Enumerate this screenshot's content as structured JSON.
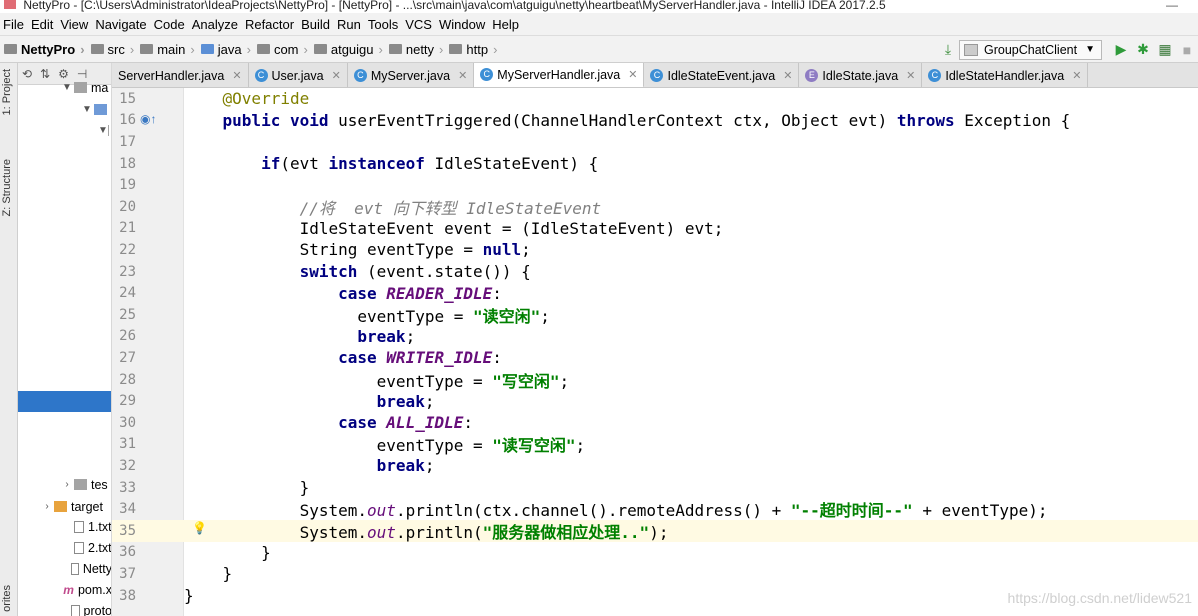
{
  "window": {
    "title": "NettyPro - [C:\\Users\\Administrator\\IdeaProjects\\NettyPro] - [NettyPro] - ...\\src\\main\\java\\com\\atguigu\\netty\\heartbeat\\MyServerHandler.java - IntelliJ IDEA 2017.2.5"
  },
  "menu": [
    "File",
    "Edit",
    "View",
    "Navigate",
    "Code",
    "Analyze",
    "Refactor",
    "Build",
    "Run",
    "Tools",
    "VCS",
    "Window",
    "Help"
  ],
  "breadcrumb": [
    "NettyPro",
    "src",
    "main",
    "java",
    "com",
    "atguigu",
    "netty",
    "http"
  ],
  "run_config": "GroupChatClient",
  "tool_windows": [
    "1: Project",
    "Z: Structure",
    "orites"
  ],
  "project_tree": [
    {
      "label": "ma"
    },
    {
      "label": ""
    },
    {
      "label": ""
    },
    {
      "label": "tes"
    },
    {
      "label": "target"
    },
    {
      "label": "1.txt"
    },
    {
      "label": "2.txt"
    },
    {
      "label": "Netty"
    },
    {
      "label": "pom.x"
    },
    {
      "label": "proto"
    }
  ],
  "tabs": [
    {
      "label": "ServerHandler.java",
      "active": false
    },
    {
      "label": "User.java",
      "active": false
    },
    {
      "label": "MyServer.java",
      "active": false
    },
    {
      "label": "MyServerHandler.java",
      "active": true
    },
    {
      "label": "IdleStateEvent.java",
      "active": false
    },
    {
      "label": "IdleState.java",
      "active": false
    },
    {
      "label": "IdleStateHandler.java",
      "active": false
    }
  ],
  "code_lines": [
    {
      "n": "15",
      "parts": [
        [
          "ann",
          "    @Override"
        ]
      ]
    },
    {
      "n": "16",
      "parts": [
        [
          "kw",
          "    public void "
        ],
        [
          "",
          "userEventTriggered(ChannelHandlerContext ctx, Object evt) "
        ],
        [
          "kw",
          "throws "
        ],
        [
          "",
          "Exception {"
        ]
      ]
    },
    {
      "n": "17",
      "parts": [
        [
          "",
          ""
        ]
      ]
    },
    {
      "n": "18",
      "parts": [
        [
          "",
          "        "
        ],
        [
          "kw",
          "if"
        ],
        [
          "",
          "(evt "
        ],
        [
          "kw",
          "instanceof "
        ],
        [
          "",
          "IdleStateEvent) {"
        ]
      ]
    },
    {
      "n": "19",
      "parts": [
        [
          "",
          ""
        ]
      ]
    },
    {
      "n": "20",
      "parts": [
        [
          "cmt",
          "            //将  evt 向下转型 IdleStateEvent"
        ]
      ]
    },
    {
      "n": "21",
      "parts": [
        [
          "",
          "            IdleStateEvent event = (IdleStateEvent) evt;"
        ]
      ]
    },
    {
      "n": "22",
      "parts": [
        [
          "",
          "            String eventType = "
        ],
        [
          "kw",
          "null"
        ],
        [
          "",
          ";"
        ]
      ]
    },
    {
      "n": "23",
      "parts": [
        [
          "",
          "            "
        ],
        [
          "kw",
          "switch "
        ],
        [
          "",
          "(event.state()) {"
        ]
      ]
    },
    {
      "n": "24",
      "parts": [
        [
          "",
          "                "
        ],
        [
          "kw",
          "case "
        ],
        [
          "field",
          "READER_IDLE"
        ],
        [
          "",
          ":"
        ]
      ]
    },
    {
      "n": "25",
      "parts": [
        [
          "",
          "                  eventType = "
        ],
        [
          "str",
          "\"读空闲\""
        ],
        [
          "",
          ";"
        ]
      ]
    },
    {
      "n": "26",
      "parts": [
        [
          "",
          "                  "
        ],
        [
          "kw",
          "break"
        ],
        [
          "",
          ";"
        ]
      ]
    },
    {
      "n": "27",
      "parts": [
        [
          "",
          "                "
        ],
        [
          "kw",
          "case "
        ],
        [
          "field",
          "WRITER_IDLE"
        ],
        [
          "",
          ":"
        ]
      ]
    },
    {
      "n": "28",
      "parts": [
        [
          "",
          "                    eventType = "
        ],
        [
          "str",
          "\"写空闲\""
        ],
        [
          "",
          ";"
        ]
      ]
    },
    {
      "n": "29",
      "parts": [
        [
          "",
          "                    "
        ],
        [
          "kw",
          "break"
        ],
        [
          "",
          ";"
        ]
      ]
    },
    {
      "n": "30",
      "parts": [
        [
          "",
          "                "
        ],
        [
          "kw",
          "case "
        ],
        [
          "field",
          "ALL_IDLE"
        ],
        [
          "",
          ":"
        ]
      ]
    },
    {
      "n": "31",
      "parts": [
        [
          "",
          "                    eventType = "
        ],
        [
          "str",
          "\"读写空闲\""
        ],
        [
          "",
          ";"
        ]
      ]
    },
    {
      "n": "32",
      "parts": [
        [
          "",
          "                    "
        ],
        [
          "kw",
          "break"
        ],
        [
          "",
          ";"
        ]
      ]
    },
    {
      "n": "33",
      "parts": [
        [
          "",
          "            }"
        ]
      ]
    },
    {
      "n": "34",
      "parts": [
        [
          "",
          "            System."
        ],
        [
          "sfield",
          "out"
        ],
        [
          "",
          ".println(ctx.channel().remoteAddress() + "
        ],
        [
          "str",
          "\"--超时时间--\""
        ],
        [
          "",
          " + eventType);"
        ]
      ]
    },
    {
      "n": "35",
      "parts": [
        [
          "",
          "            System."
        ],
        [
          "sfield",
          "out"
        ],
        [
          "",
          ".println("
        ],
        [
          "str",
          "\"服务器做相应处理..\""
        ],
        [
          "",
          ");"
        ]
      ]
    },
    {
      "n": "36",
      "parts": [
        [
          "",
          "        }"
        ]
      ]
    },
    {
      "n": "37",
      "parts": [
        [
          "",
          "    }"
        ]
      ]
    },
    {
      "n": "38",
      "parts": [
        [
          "",
          "}"
        ]
      ]
    }
  ],
  "current_line": "35",
  "watermark": "https://blog.csdn.net/lidew521",
  "icons": {
    "run": "run-icon",
    "debug": "debug-icon",
    "coverage": "coverage-icon",
    "override": "override-marker-icon",
    "bulb": "intention-bulb-icon"
  }
}
